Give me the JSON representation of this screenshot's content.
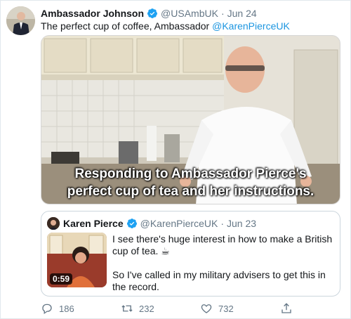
{
  "tweet": {
    "author_name": "Ambassador Johnson",
    "handle": "@USAmbUK",
    "separator": "·",
    "date": "Jun 24",
    "text_main": "The perfect cup of coffee, Ambassador ",
    "text_mention": "@KarenPierceUK"
  },
  "media": {
    "caption_line1": "Responding to Ambassador Pierce's",
    "caption_line2": "perfect cup of tea and her instructions."
  },
  "quoted_tweet": {
    "author_name": "Karen Pierce",
    "handle": "@KarenPierceUK",
    "separator": "·",
    "date": "Jun 23",
    "line1": "I see there's huge interest in how to make a British",
    "line2": "cup of tea. ☕",
    "line3": "So I've called in my military advisers to get this in",
    "line4": "the record.",
    "video_duration": "0:59"
  },
  "actions": {
    "replies": "186",
    "retweets": "232",
    "likes": "732"
  },
  "colors": {
    "link": "#1b95e0",
    "verified": "#1da1f2",
    "secondary_text": "#657786",
    "border": "#e1e8ed"
  },
  "icons": [
    "verified-badge-icon",
    "reply-icon",
    "retweet-icon",
    "like-icon",
    "share-icon"
  ]
}
